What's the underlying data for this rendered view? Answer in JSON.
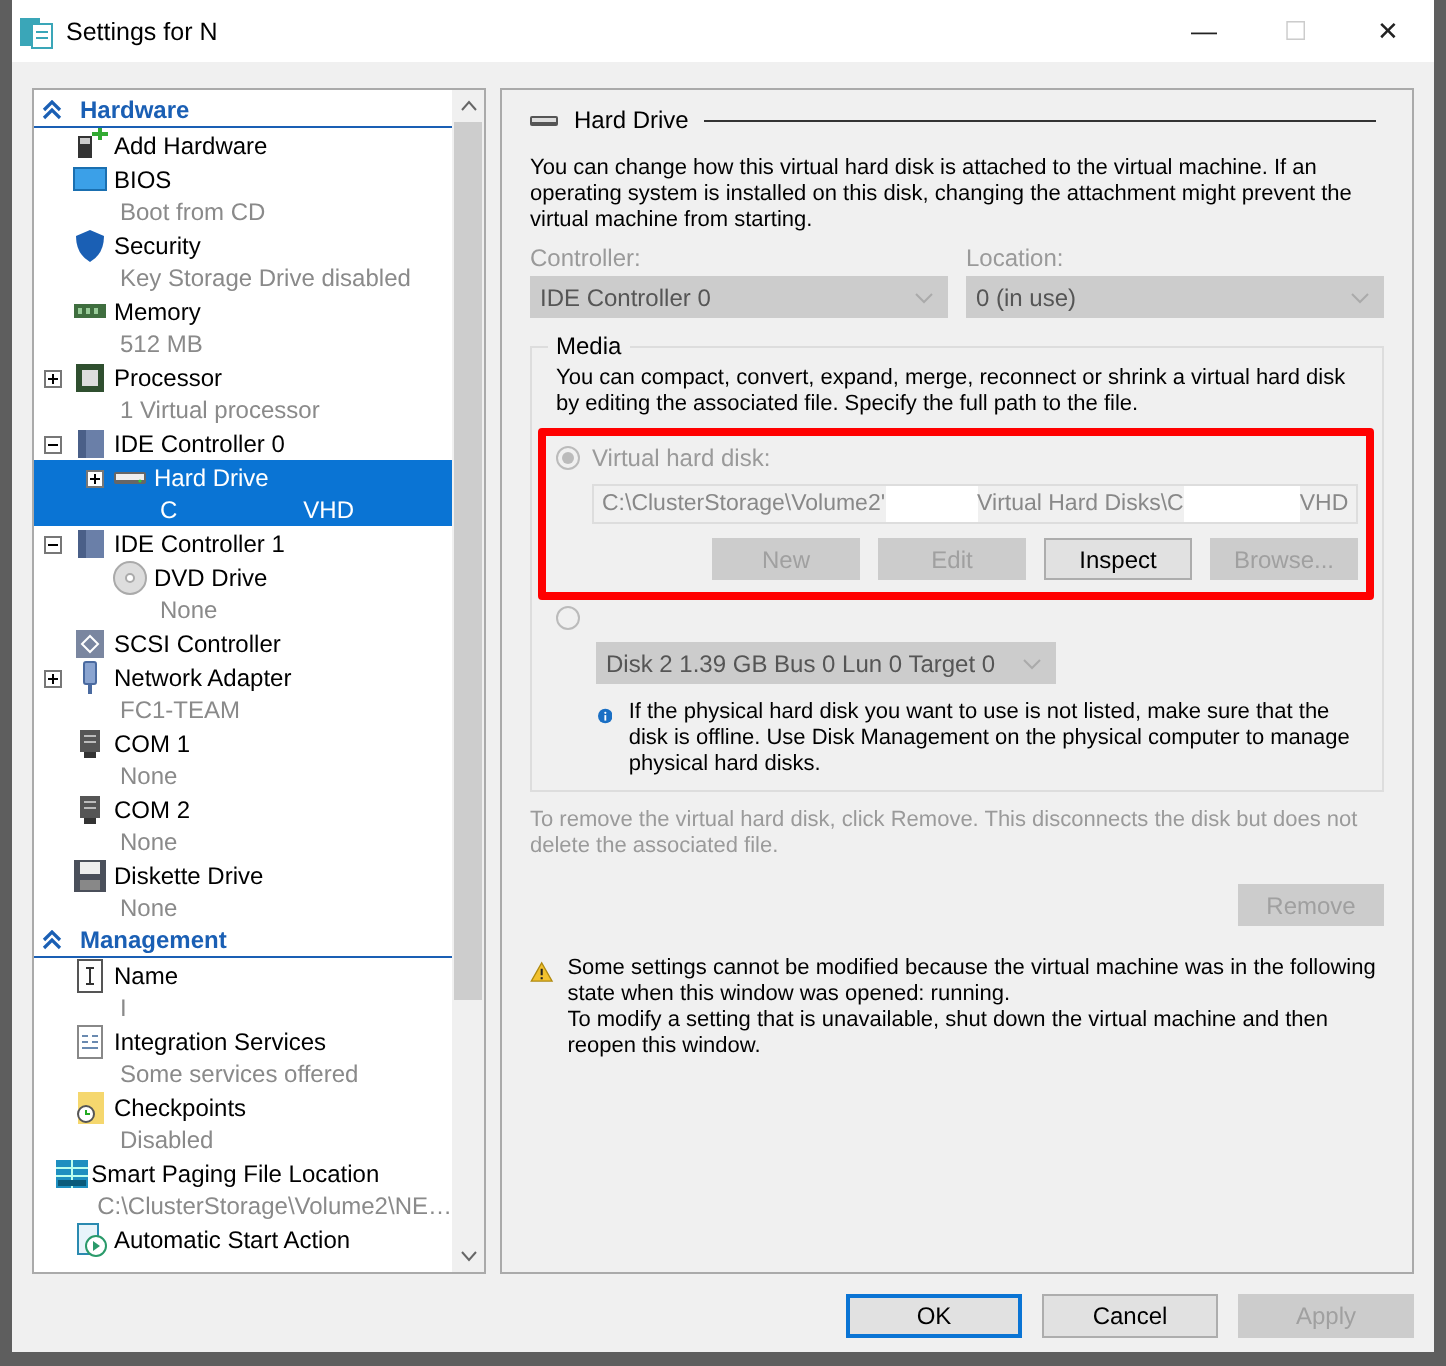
{
  "window": {
    "title": "Settings for N",
    "controls": [
      {
        "glyph": "—",
        "disabled": false
      },
      {
        "glyph": "☐",
        "disabled": true
      },
      {
        "glyph": "✕",
        "disabled": false
      }
    ]
  },
  "tree": {
    "sections": [
      {
        "title": "Hardware",
        "items": [
          {
            "label": "Add Hardware",
            "selected": false
          },
          {
            "label": "BIOS",
            "sub": "Boot from CD",
            "selected": false
          },
          {
            "label": "Security",
            "sub": "Key Storage Drive disabled",
            "selected": false
          },
          {
            "label": "Memory",
            "sub": "512 MB",
            "selected": false
          },
          {
            "label": "Processor",
            "sub": "1 Virtual processor",
            "expanded": false,
            "selected": false
          },
          {
            "label": "IDE Controller 0",
            "expanded": true,
            "selected": false,
            "children": [
              {
                "label": "Hard Drive",
                "sub_parts": [
                  "C",
                  "VHD"
                ],
                "expanded": false,
                "selected": true
              }
            ]
          },
          {
            "label": "IDE Controller 1",
            "expanded": true,
            "selected": false,
            "children": [
              {
                "label": "DVD Drive",
                "sub": "None",
                "selected": false
              }
            ]
          },
          {
            "label": "SCSI Controller",
            "selected": false
          },
          {
            "label": "Network Adapter",
            "sub": "FC1-TEAM",
            "expanded": false,
            "selected": false
          },
          {
            "label": "COM 1",
            "sub": "None",
            "selected": false
          },
          {
            "label": "COM 2",
            "sub": "None",
            "selected": false
          },
          {
            "label": "Diskette Drive",
            "sub": "None",
            "selected": false
          }
        ]
      },
      {
        "title": "Management",
        "items": [
          {
            "label": "Name",
            "sub": "I",
            "selected": false
          },
          {
            "label": "Integration Services",
            "sub": "Some services offered",
            "selected": false
          },
          {
            "label": "Checkpoints",
            "sub": "Disabled",
            "selected": false
          },
          {
            "label": "Smart Paging File Location",
            "sub": "C:\\ClusterStorage\\Volume2\\NE…",
            "selected": false
          },
          {
            "label": "Automatic Start Action",
            "selected": false
          }
        ]
      }
    ]
  },
  "panel": {
    "title": "Hard Drive",
    "intro": "You can change how this virtual hard disk is attached to the virtual machine. If an operating system is installed on this disk, changing the attachment might prevent the virtual machine from starting.",
    "controller": {
      "label": "Controller:",
      "value": "IDE Controller 0",
      "disabled": true
    },
    "location": {
      "label": "Location:",
      "value": "0 (in use)",
      "disabled": true
    },
    "media": {
      "title": "Media",
      "text": "You can compact, convert, expand, merge, reconnect or shrink a virtual hard disk by editing the associated file. Specify the full path to the file.",
      "virtual_disk": {
        "label": "Virtual hard disk:",
        "selected": true,
        "disabled": true
      },
      "path_parts": [
        "C:\\ClusterStorage\\Volume2'",
        "Virtual Hard Disks\\C",
        "VHD"
      ],
      "buttons": [
        {
          "label": "New",
          "disabled": true
        },
        {
          "label": "Edit",
          "disabled": true
        },
        {
          "label": "Inspect",
          "disabled": false
        },
        {
          "label": "Browse...",
          "disabled": true
        }
      ],
      "physical_disk": {
        "selected": false,
        "disabled": true
      },
      "disk_select": {
        "value": "Disk 2 1.39 GB Bus 0 Lun 0 Target 0",
        "disabled": true
      },
      "info": "If the physical hard disk you want to use is not listed, make sure that the disk is offline. Use Disk Management on the physical computer to manage physical hard disks."
    },
    "remove_text": "To remove the virtual hard disk, click Remove. This disconnects the disk but does not delete the associated file.",
    "remove_button": {
      "label": "Remove",
      "disabled": true
    },
    "warning": [
      "Some settings cannot be modified because the virtual machine was in the following state when this window was opened: running.",
      "To modify a setting that is unavailable, shut down the virtual machine and then reopen this window."
    ]
  },
  "buttons": [
    {
      "label": "OK",
      "default": true,
      "disabled": false
    },
    {
      "label": "Cancel",
      "default": false,
      "disabled": false
    },
    {
      "label": "Apply",
      "default": false,
      "disabled": true
    }
  ]
}
